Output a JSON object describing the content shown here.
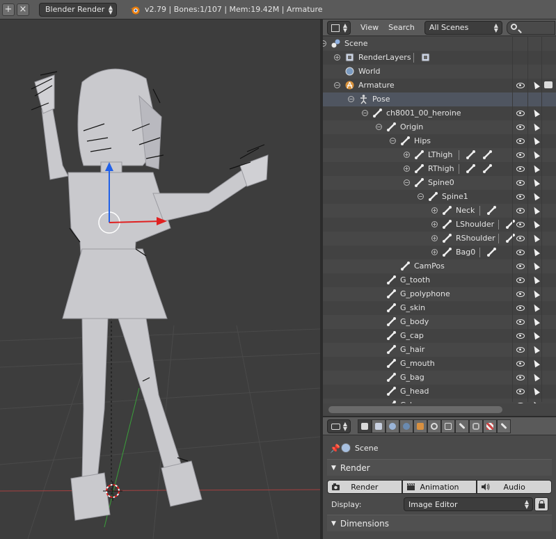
{
  "topbar": {
    "engine": "Blender Render",
    "status": "v2.79 | Bones:1/107  | Mem:19.42M | Armature"
  },
  "outliner": {
    "menu_view": "View",
    "menu_search": "Search",
    "scenes_select": "All Scenes",
    "rows": [
      {
        "label": "Scene",
        "type": "scene"
      },
      {
        "label": "RenderLayers",
        "type": "renderlayers"
      },
      {
        "label": "World",
        "type": "world"
      },
      {
        "label": "Armature",
        "type": "armature"
      },
      {
        "label": "Pose",
        "type": "pose"
      },
      {
        "label": "ch8001_00_heroine",
        "type": "bone"
      },
      {
        "label": "Origin",
        "type": "bone"
      },
      {
        "label": "Hips",
        "type": "bone"
      },
      {
        "label": "LThigh",
        "type": "bone"
      },
      {
        "label": "RThigh",
        "type": "bone"
      },
      {
        "label": "Spine0",
        "type": "bone"
      },
      {
        "label": "Spine1",
        "type": "bone"
      },
      {
        "label": "Neck",
        "type": "bone"
      },
      {
        "label": "LShoulder",
        "type": "bone"
      },
      {
        "label": "RShoulder",
        "type": "bone"
      },
      {
        "label": "Bag0",
        "type": "bone"
      },
      {
        "label": "CamPos",
        "type": "bone"
      },
      {
        "label": "G_tooth",
        "type": "bone"
      },
      {
        "label": "G_polyphone",
        "type": "bone"
      },
      {
        "label": "G_skin",
        "type": "bone"
      },
      {
        "label": "G_body",
        "type": "bone"
      },
      {
        "label": "G_cap",
        "type": "bone"
      },
      {
        "label": "G_hair",
        "type": "bone"
      },
      {
        "label": "G_mouth",
        "type": "bone"
      },
      {
        "label": "G_bag",
        "type": "bone"
      },
      {
        "label": "G_head",
        "type": "bone"
      },
      {
        "label": "G_brow",
        "type": "bone"
      }
    ]
  },
  "properties": {
    "scene_label": "Scene",
    "render_panel": "Render",
    "render_button": "Render",
    "animation_button": "Animation",
    "audio_button": "Audio",
    "display_label": "Display:",
    "display_value": "Image Editor",
    "dimensions_panel": "Dimensions"
  },
  "colors": {
    "x_axis": "#e02020",
    "y_axis": "#2060e8",
    "ground_y": "#3aa03a",
    "selection_blue": "#4f5560"
  }
}
